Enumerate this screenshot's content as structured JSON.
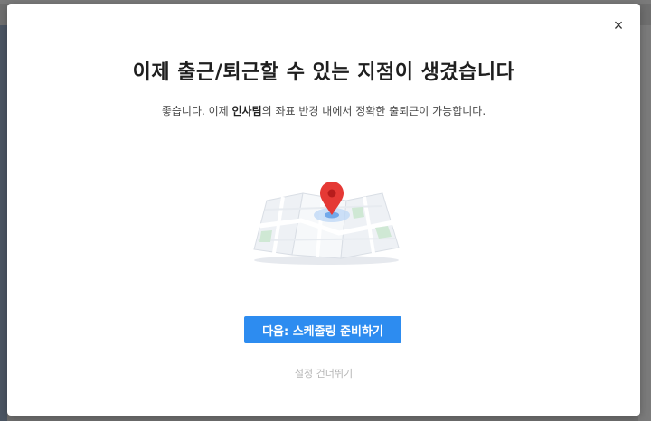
{
  "modal": {
    "title": "이제 출근/퇴근할 수 있는 지점이 생겼습니다",
    "subtitle_prefix": "좋습니다. 이제 ",
    "subtitle_emphasis": "인사팀",
    "subtitle_suffix": "의 좌표 반경 내에서 정확한 출퇴근이 가능합니다.",
    "close_label": "×",
    "primary_button_label": "다음: 스케줄링 준비하기",
    "skip_label": "설정 건너뛰기"
  },
  "colors": {
    "primary": "#2d8cf0",
    "pin": "#e53935",
    "overlay": "#6f6f6f"
  },
  "icons": {
    "close": "close-icon",
    "illustration": "map-pin-illustration"
  }
}
